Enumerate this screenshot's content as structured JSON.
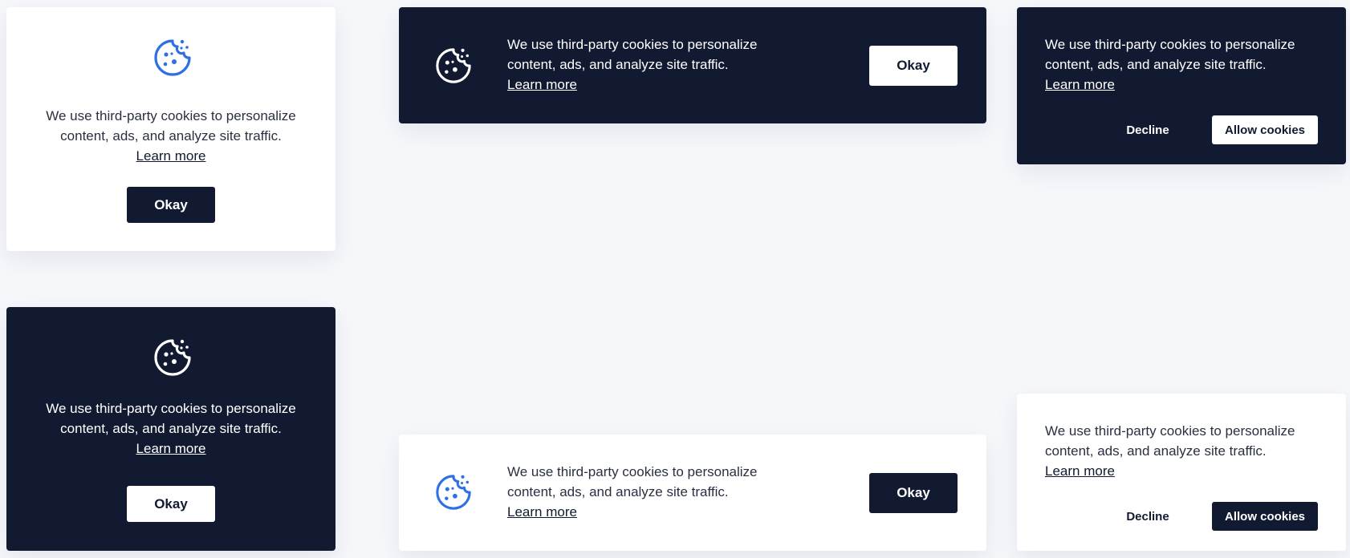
{
  "colors": {
    "page_background": "#f6f7fb",
    "dark_navy": "#111a30",
    "white": "#ffffff",
    "accent_blue": "#2f6fe4"
  },
  "icons": {
    "cookie": "cookie-icon"
  },
  "banner_vertical_light": {
    "line1": "We use third-party cookies to personalize",
    "line2": "content, ads, and analyze site traffic.",
    "learn_more": "Learn more",
    "okay": "Okay"
  },
  "banner_horizontal_dark": {
    "line1": "We use third-party cookies to personalize",
    "line2": "content, ads, and analyze site traffic.",
    "learn_more": "Learn more",
    "okay": "Okay"
  },
  "banner_two_button_dark": {
    "line1": "We use third-party cookies to personalize",
    "line2": "content, ads, and analyze site traffic.",
    "learn_more": "Learn more",
    "decline": "Decline",
    "allow": "Allow cookies"
  },
  "banner_vertical_dark": {
    "line1": "We use third-party cookies to personalize",
    "line2": "content, ads, and analyze site traffic.",
    "learn_more": "Learn more",
    "okay": "Okay"
  },
  "banner_horizontal_light": {
    "line1": "We use third-party cookies to personalize",
    "line2": "content, ads, and analyze site traffic.",
    "learn_more": "Learn more",
    "okay": "Okay"
  },
  "banner_two_button_light": {
    "line1": "We use third-party cookies to personalize",
    "line2": "content, ads, and analyze site traffic.",
    "learn_more": "Learn more",
    "decline": "Decline",
    "allow": "Allow cookies"
  }
}
